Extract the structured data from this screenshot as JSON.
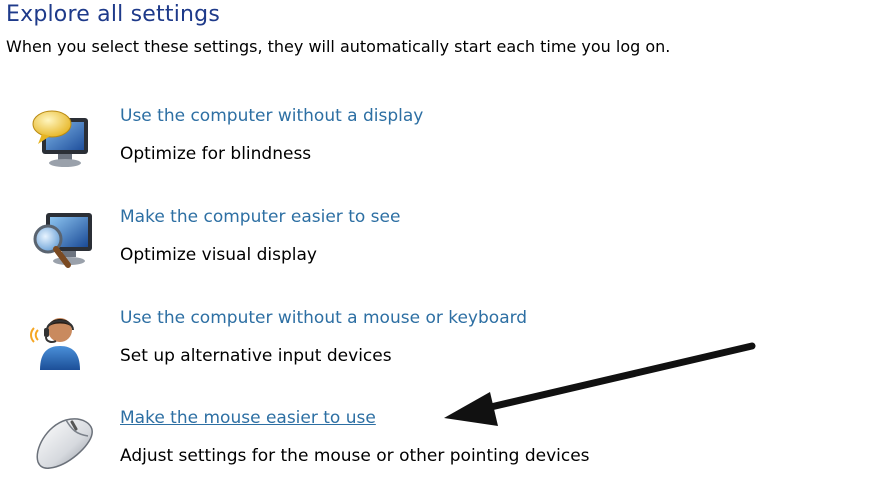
{
  "page": {
    "title": "Explore all settings",
    "subtitle": "When you select these settings, they will automatically start each time you log on."
  },
  "options": [
    {
      "link": "Use the computer without a display",
      "description": "Optimize for blindness",
      "icon": "monitor-speech-bubble-icon"
    },
    {
      "link": "Make the computer easier to see",
      "description": "Optimize visual display",
      "icon": "monitor-magnifier-icon"
    },
    {
      "link": "Use the computer without a mouse or keyboard",
      "description": "Set up alternative input devices",
      "icon": "user-headset-icon"
    },
    {
      "link": "Make the mouse easier to use",
      "description": "Adjust settings for the mouse or other pointing devices",
      "icon": "mouse-icon",
      "hovered": true
    }
  ],
  "colors": {
    "heading": "#1e3a8a",
    "link": "#2d6fa3",
    "text": "#000000",
    "arrow": "#111111"
  }
}
